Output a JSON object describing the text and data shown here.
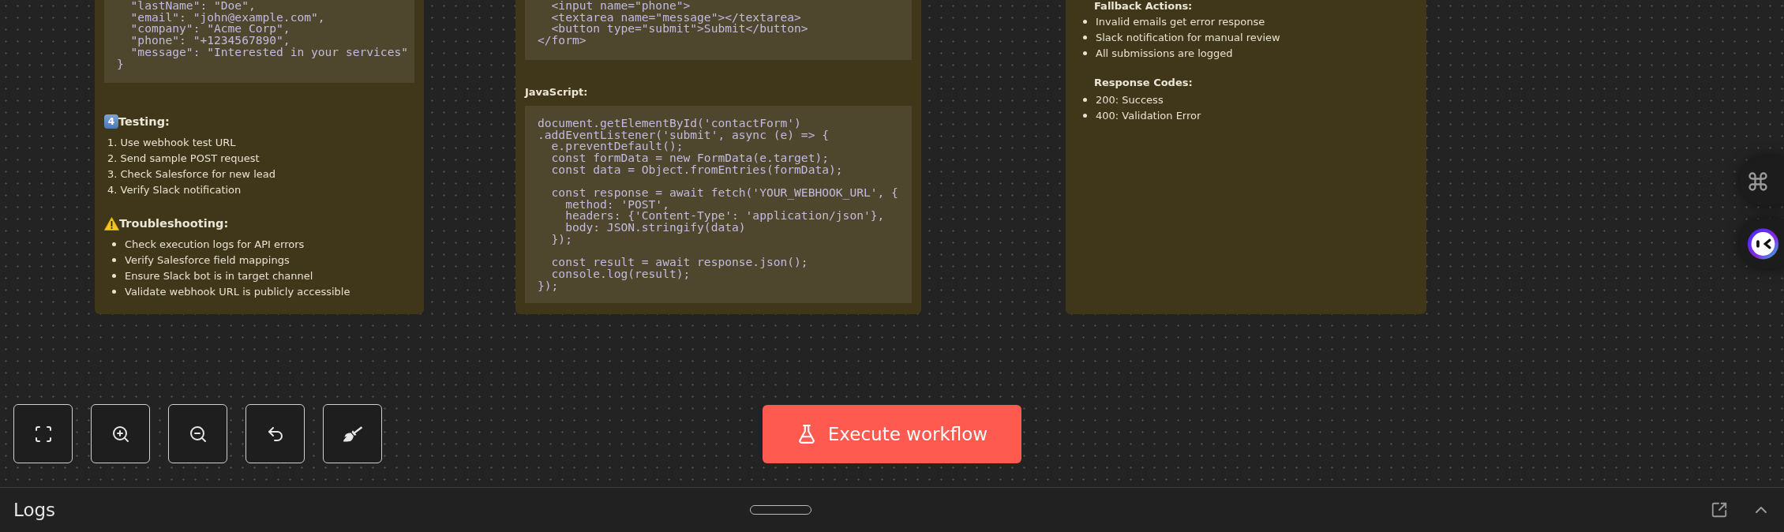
{
  "cards": [
    {
      "sections": [
        {
          "kind": "code",
          "code": "  \"lastName\": \"Doe\",\n  \"email\": \"john@example.com\",\n  \"company\": \"Acme Corp\",\n  \"phone\": \"+1234567890\",\n  \"message\": \"Interested in your services\"\n}"
        },
        {
          "kind": "keycap_heading",
          "keycap": "4",
          "text": "Testing:"
        },
        {
          "kind": "numbered",
          "items": [
            "1. Use webhook test URL",
            "2. Send sample POST request",
            "3. Check Salesforce for new lead",
            "4. Verify Slack notification"
          ]
        },
        {
          "kind": "warning_heading",
          "text": "Troubleshooting:"
        },
        {
          "kind": "bullets",
          "items": [
            "Check execution logs for API errors",
            "Verify Salesforce field mappings",
            "Ensure Slack bot is in target channel",
            "Validate webhook URL is publicly accessible"
          ]
        }
      ]
    },
    {
      "sections": [
        {
          "kind": "code",
          "code": "  <input name=\"phone\">\n  <textarea name=\"message\"></textarea>\n  <button type=\"submit\">Submit</button>\n</form>"
        },
        {
          "kind": "label",
          "text": "JavaScript:"
        },
        {
          "kind": "code",
          "code": "document.getElementById('contactForm')\n.addEventListener('submit', async (e) => {\n  e.preventDefault();\n  const formData = new FormData(e.target);\n  const data = Object.fromEntries(formData);\n\n  const response = await fetch('YOUR_WEBHOOK_URL', {\n    method: 'POST',\n    headers: {'Content-Type': 'application/json'},\n    body: JSON.stringify(data)\n  });\n\n  const result = await response.json();\n  console.log(result);\n});"
        }
      ]
    },
    {
      "sections": [
        {
          "kind": "label",
          "text": "Fallback Actions:"
        },
        {
          "kind": "bullets",
          "items": [
            "Invalid emails get error response",
            "Slack notification for manual review",
            "All submissions are logged"
          ]
        },
        {
          "kind": "label",
          "text": "Response Codes:"
        },
        {
          "kind": "bullets",
          "items": [
            "200: Success",
            "400: Validation Error"
          ]
        }
      ]
    }
  ],
  "execute_button": "Execute workflow",
  "logs": {
    "title": "Logs"
  }
}
